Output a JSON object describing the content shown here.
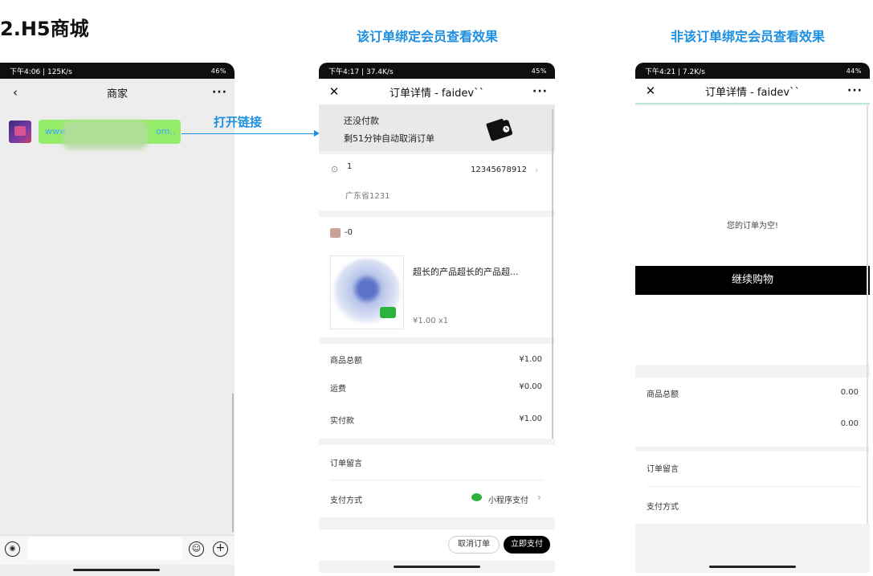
{
  "main_title": "2.H5商城",
  "caption_bound": "该订单绑定会员查看效果",
  "caption_unbound": "非该订单绑定会员查看效果",
  "link_label": "打开链接",
  "chat": {
    "status_time": "下午4:06 | 125K/s",
    "status_right": "46%",
    "nav_back": "‹",
    "nav_title": "商家",
    "nav_more": "···",
    "bubble_start": "www",
    "bubble_end": "om.."
  },
  "order": {
    "status_time": "下午4:17 | 37.4K/s",
    "status_right": "45%",
    "nav_close": "✕",
    "nav_title": "订单详情 - faidev``",
    "nav_more": "···",
    "unpaid_title": "还没付款",
    "unpaid_sub": "剩51分钟自动取消订单",
    "address_name": "1",
    "address_phone": "12345678912",
    "address_line": "广东省1231",
    "shop_name": "-0",
    "product_title": "超长的产品超长的产品超...",
    "product_price": "¥1.00",
    "product_qty": "x1",
    "rows": [
      {
        "label": "商品总额",
        "value": "¥1.00"
      },
      {
        "label": "运费",
        "value": "¥0.00"
      },
      {
        "label": "实付款",
        "value": "¥1.00"
      }
    ],
    "note_label": "订单留言",
    "pay_label": "支付方式",
    "pay_value": "小程序支付",
    "pay_chev": "›",
    "btn_cancel": "取消订单",
    "btn_pay": "立即支付"
  },
  "empty": {
    "status_time": "下午4:21 | 7.2K/s",
    "status_right": "44%",
    "nav_close": "✕",
    "nav_title": "订单详情 - faidev``",
    "nav_more": "···",
    "empty_text": "您的订单为空!",
    "continue_btn": "继续购物",
    "sum_label": "商品总额",
    "sum_value": "0.00",
    "sum_total": "0.00",
    "note_label": "订单留言",
    "pay_label": "支付方式"
  },
  "colors": {
    "accent_blue": "#1e8fe0",
    "wechat_green": "#95ec69",
    "pay_green": "#2cb33b"
  }
}
